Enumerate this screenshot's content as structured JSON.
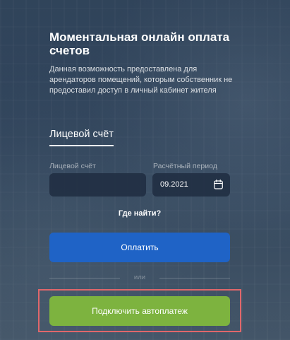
{
  "header": {
    "title": "Моментальная онлайн оплата счетов",
    "description": "Данная возможность предоставлена для арендаторов помещений, которым собственник не предоставил доступ в личный кабинет жителя"
  },
  "tabs": {
    "active_label": "Лицевой счёт"
  },
  "form": {
    "account_label": "Лицевой счёт",
    "account_value": "",
    "period_label": "Расчётный период",
    "period_value": "09.2021",
    "where_to_find": "Где найти?"
  },
  "actions": {
    "pay_label": "Оплатить",
    "or_label": "или",
    "autopay_label": "Подключить автоплатеж"
  },
  "colors": {
    "pay_button": "#1f63c6",
    "autopay_button": "#7db33f",
    "highlight_border": "#e0676b"
  },
  "icons": {
    "period_icon": "calendar-icon"
  }
}
